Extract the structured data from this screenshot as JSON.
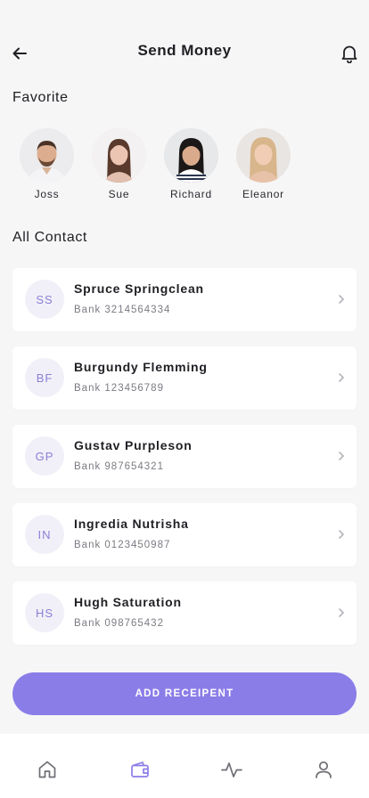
{
  "header": {
    "title": "Send Money",
    "back_icon": "arrow-left-icon",
    "bell_icon": "bell-icon"
  },
  "favorites": {
    "title": "Favorite",
    "people": [
      {
        "name": "Joss"
      },
      {
        "name": "Sue"
      },
      {
        "name": "Richard"
      },
      {
        "name": "Eleanor"
      }
    ]
  },
  "contacts": {
    "title": "All Contact",
    "items": [
      {
        "initials": "SS",
        "name": "Spruce Springclean",
        "bank": "Bank 3214564334"
      },
      {
        "initials": "BF",
        "name": "Burgundy Flemming",
        "bank": "Bank 123456789"
      },
      {
        "initials": "GP",
        "name": "Gustav Purpleson",
        "bank": "Bank 987654321"
      },
      {
        "initials": "IN",
        "name": "Ingredia Nutrisha",
        "bank": "Bank 0123450987"
      },
      {
        "initials": "HS",
        "name": "Hugh Saturation",
        "bank": "Bank 098765432"
      }
    ]
  },
  "add_button": {
    "label": "ADD RECEIPENT"
  },
  "tabbar": {
    "items": [
      {
        "icon": "home-icon",
        "active": false
      },
      {
        "icon": "wallet-icon",
        "active": true
      },
      {
        "icon": "activity-icon",
        "active": false
      },
      {
        "icon": "profile-icon",
        "active": false
      }
    ]
  },
  "colors": {
    "accent": "#8b7de8",
    "initials_bg": "#f1f0f8",
    "initials_text": "#8b80d6",
    "background": "#f6f6f7"
  }
}
